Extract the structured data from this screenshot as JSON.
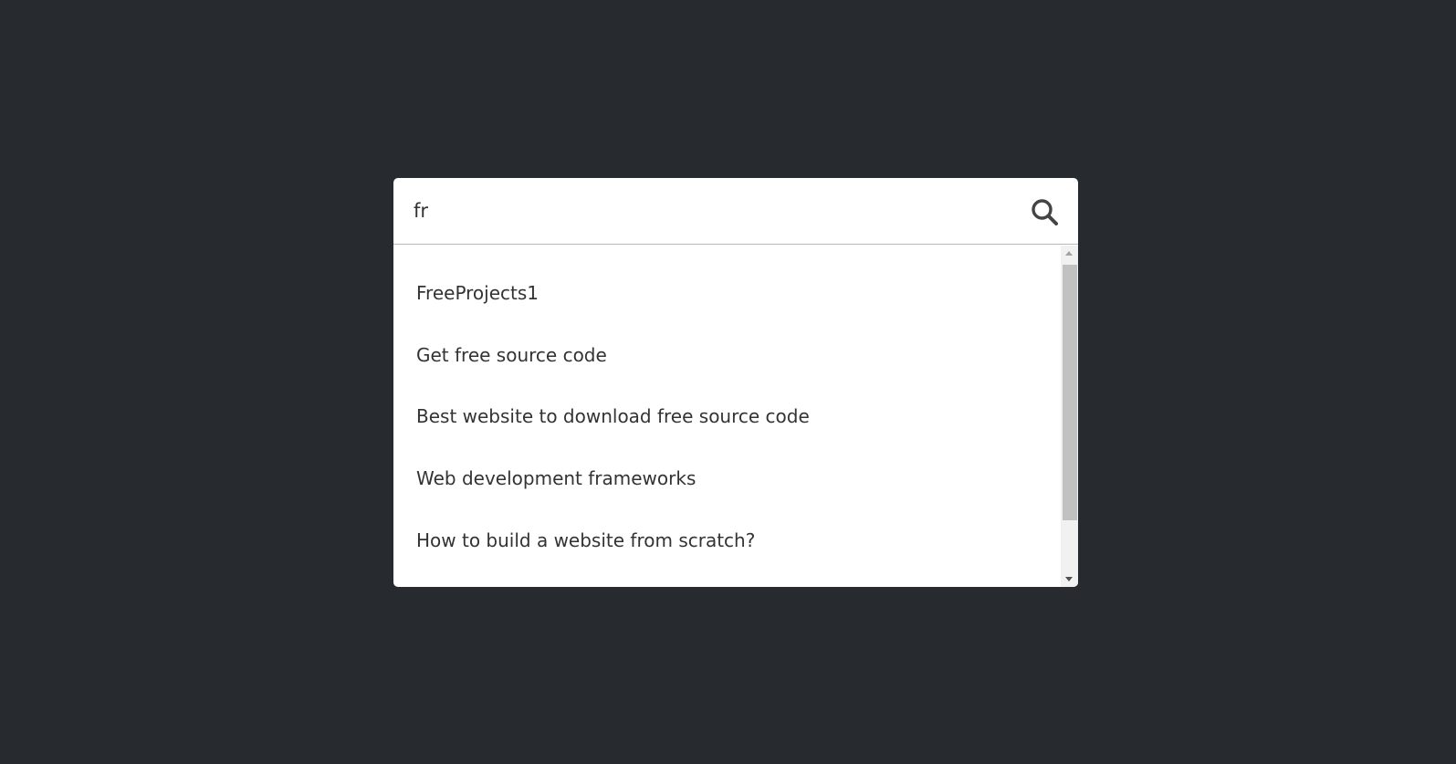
{
  "search": {
    "value": "fr",
    "icon": "search-icon"
  },
  "results": [
    "FreeProjects1",
    "Get free source code",
    "Best website to download free source code",
    "Web development frameworks",
    "How to build a website from scratch?"
  ],
  "colors": {
    "background": "#272a2f",
    "panel": "#ffffff",
    "text": "#333333",
    "icon": "#444444"
  }
}
